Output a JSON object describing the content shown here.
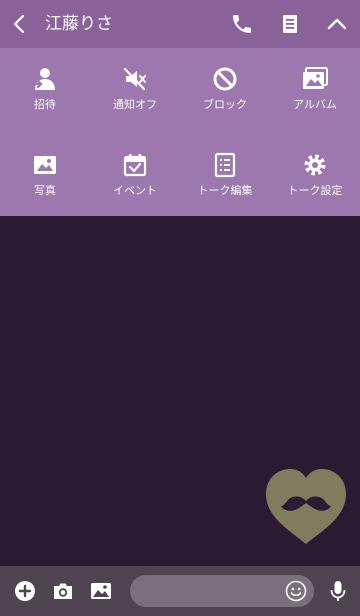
{
  "header": {
    "title": "江藤りさ"
  },
  "menu": [
    {
      "label": "招待",
      "icon": "invite-icon"
    },
    {
      "label": "通知オフ",
      "icon": "mute-icon"
    },
    {
      "label": "ブロック",
      "icon": "block-icon"
    },
    {
      "label": "アルバム",
      "icon": "album-icon"
    },
    {
      "label": "写真",
      "icon": "photo-icon"
    },
    {
      "label": "イベント",
      "icon": "event-icon"
    },
    {
      "label": "トーク編集",
      "icon": "talk-edit-icon"
    },
    {
      "label": "トーク設定",
      "icon": "settings-icon"
    }
  ],
  "colors": {
    "header_bg": "#8a629a",
    "menu_bg": "#9c78ae",
    "content_bg": "#2a1b33",
    "bottom_bg": "#4e4450",
    "input_bg": "#7a7079",
    "sticker_heart": "#7f7d5e",
    "sticker_mustache": "#2a1b33"
  }
}
